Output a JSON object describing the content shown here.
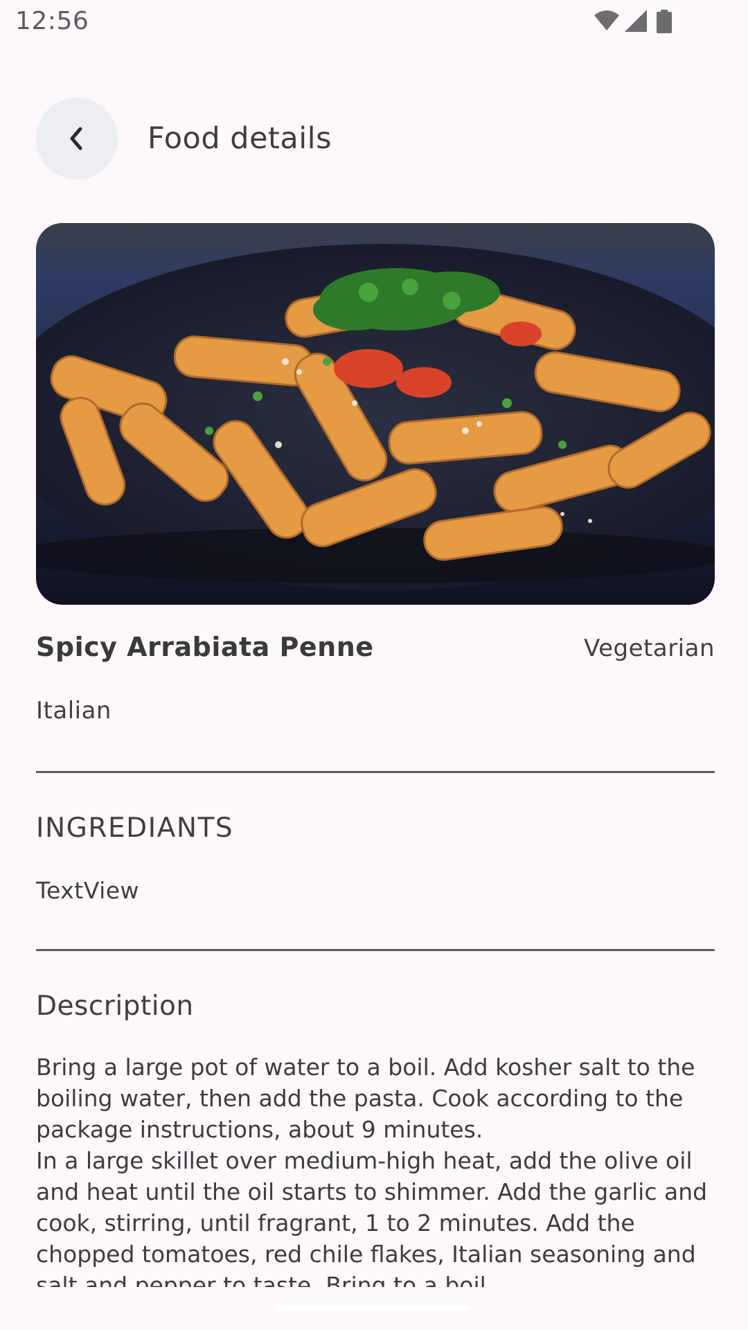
{
  "status_bar": {
    "time": "12:56",
    "icons": [
      "wifi-icon",
      "cellular-signal-icon",
      "battery-icon"
    ]
  },
  "header": {
    "back_icon": "chevron-left-icon",
    "title": "Food details"
  },
  "food": {
    "image": "pasta-dish-photo",
    "name": "Spicy Arrabiata Penne",
    "category": "Vegetarian",
    "area": "Italian"
  },
  "ingredients": {
    "heading": "INGREDIANTS",
    "text": "TextView"
  },
  "description": {
    "heading": "Description",
    "text": "Bring a large pot of water to a boil. Add kosher salt to the boiling water, then add the pasta. Cook according to the package instructions, about 9 minutes.\nIn a large skillet over medium-high heat, add the olive oil and heat until the oil starts to shimmer. Add the garlic and cook, stirring, until fragrant, 1 to 2 minutes. Add the chopped tomatoes, red chile flakes, Italian seasoning and salt and pepper to taste. Bring to a boil"
  },
  "colors": {
    "background": "#fef7fc",
    "back_button_bg": "#edeef2",
    "divider": "#5c5c5e"
  }
}
